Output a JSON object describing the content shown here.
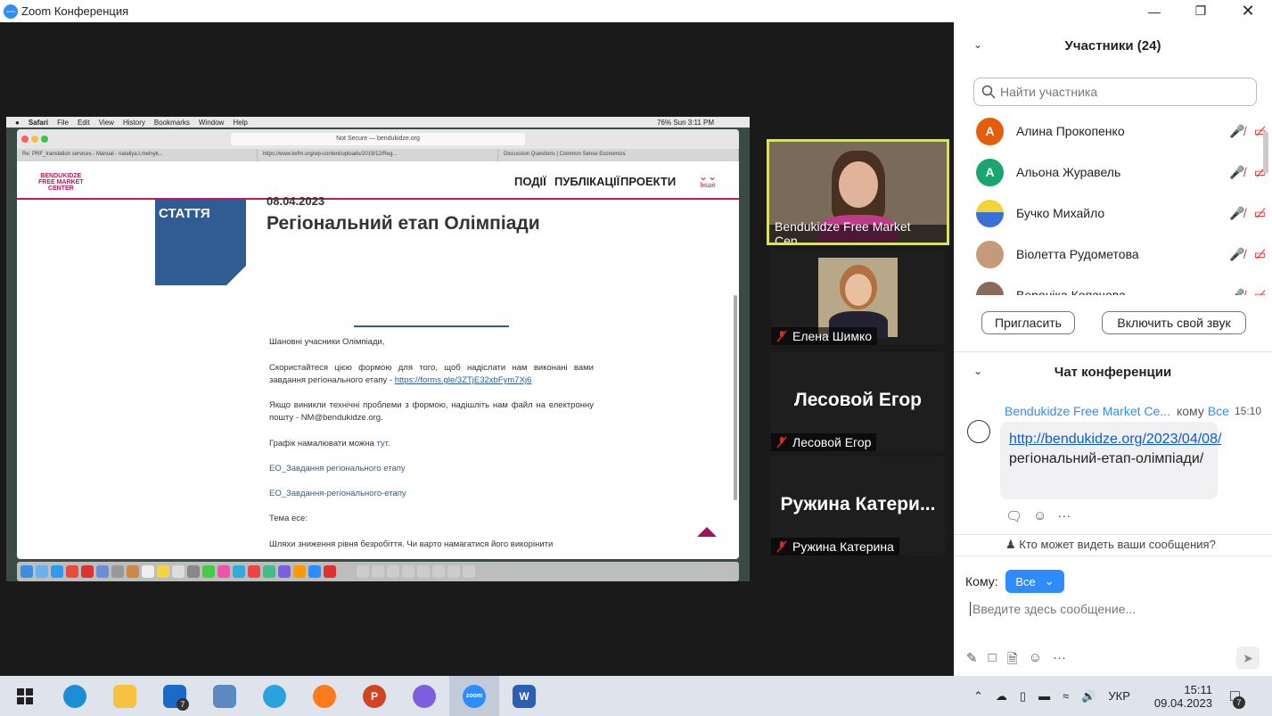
{
  "window": {
    "title": "Zoom Конференция"
  },
  "shared": {
    "mac_menu": [
      "Safari",
      "File",
      "Edit",
      "View",
      "History",
      "Bookmarks",
      "Window",
      "Help"
    ],
    "mac_status": "76%  Sun 3:11 PM",
    "url": "Not Secure — bendukidze.org",
    "tabs": [
      "Re: PRF_translation services - Manual - nataliya.t.melnyk...",
      "https://www.kefm.org/wp-content/uploads/2019/12/Reg...",
      "Discussion Questions | Common Sense Economics"
    ],
    "logo_lines": [
      "BENDUKIDZE",
      "FREE MARKET",
      "CENTER"
    ],
    "nav": [
      "ПОДІЇ",
      "ПУБЛІКАЦІЇ",
      "ПРОЕКТИ"
    ],
    "nav_more": "Інше",
    "card_label": "СТАТТЯ",
    "date": "08.04.2023",
    "headline": "Регіональний етап Олімпіади",
    "greeting": "Шановні учасники Олімпіади,",
    "p1": "Скористайтеся цією формою для того, щоб надіслати нам виконані вами завдання регіонального етапу - ",
    "p1_link": "https://forms.gle/3ZTjE32xbFym7Xj6",
    "p2": "Якщо виникли технічні проблеми з формою, надішліть нам файл на електронну пошту - NM@bendukidze.org.",
    "p3": "Графік намалювати можна ",
    "p3_link": "тут",
    "p3_end": ".",
    "link1": "ЕО_Завдання регіонального етапу",
    "link2": "ЕО_Завдання-регіонального-етапу",
    "theme_label": "Тема есе:",
    "p4": "Шляхи зниження рівня безробіття. Чи варто намагатися його викорінити"
  },
  "gallery": [
    {
      "name": "Bendukidze Free Market Cen...",
      "active": true
    },
    {
      "name": "Елена Шимко",
      "muted": true
    },
    {
      "name": "Лесовой Егор",
      "big": "Лесовой Егор",
      "muted": true
    },
    {
      "name": "Ружина Катерина",
      "big": "Ружина  Катери...",
      "muted": true
    }
  ],
  "participants": {
    "title": "Участники (24)",
    "search_placeholder": "Найти участника",
    "list": [
      {
        "name": "Алина Прокопенко",
        "initial": "А",
        "color": "#e35d0a"
      },
      {
        "name": "Альона Журавель",
        "initial": "А",
        "color": "#1aa56f"
      },
      {
        "name": "Бучко Михайло",
        "initial": "",
        "color": "#3a6fd8"
      },
      {
        "name": "Віолетта Рудометова",
        "initial": "",
        "color": "#c49a7a"
      },
      {
        "name": "Вероніка Копачова",
        "initial": "",
        "color": "#8a6a5a"
      }
    ],
    "invite": "Пригласить",
    "unmute": "Включить свой звук"
  },
  "chat": {
    "title": "Чат конференции",
    "from": "Bendukidze Free Market Ce...",
    "to_label": "кому",
    "to_value": "Все",
    "time": "15:10",
    "msg_link": "http://bendukidze.org/2023/04/08/",
    "msg_text": "регіональний-етап-олімпіади/",
    "who_can_see": "Кто может видеть ваши сообщения?",
    "to_field_label": "Кому:",
    "to_field_value": "Все",
    "input_placeholder": "Введите здесь сообщение..."
  },
  "taskbar": {
    "lang": "УКР",
    "time": "15:11",
    "date": "09.04.2023",
    "mail_badge": "7",
    "notif_badge": "7"
  }
}
